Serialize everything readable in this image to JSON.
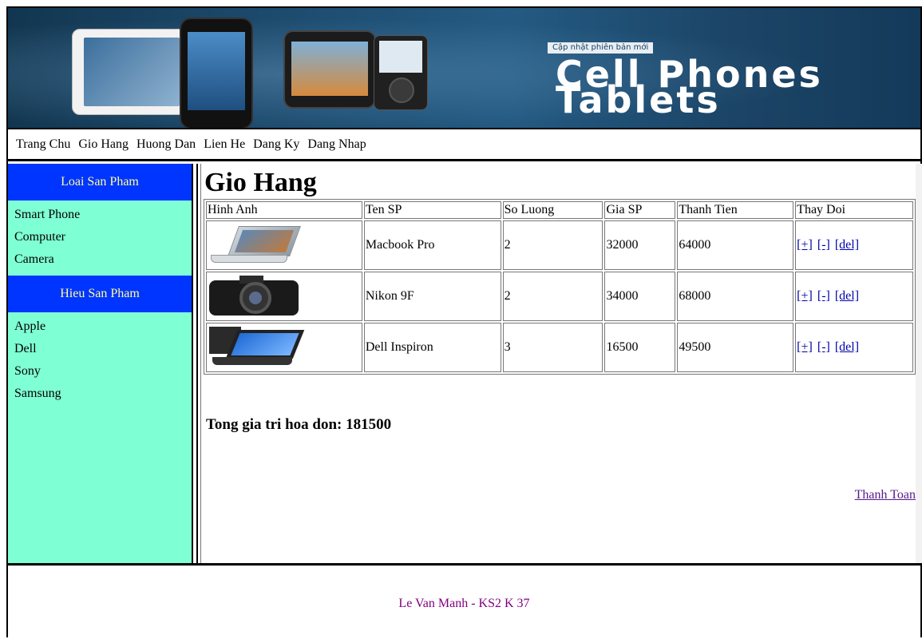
{
  "banner": {
    "tagline": "Cập nhật phiên bản mới",
    "title_line1": "Cell Phones",
    "title_line2": "Tablets"
  },
  "nav": {
    "items": [
      "Trang Chu",
      "Gio Hang",
      "Huong Dan",
      "Lien He",
      "Dang Ky",
      "Dang Nhap"
    ]
  },
  "sidebar": {
    "categories_title": "Loai San Pham",
    "categories": [
      "Smart Phone",
      "Computer",
      "Camera"
    ],
    "brands_title": "Hieu San Pham",
    "brands": [
      "Apple",
      "Dell",
      "Sony",
      "Samsung"
    ]
  },
  "cart": {
    "title": "Gio Hang",
    "headers": [
      "Hinh Anh",
      "Ten SP",
      "So Luong",
      "Gia SP",
      "Thanh Tien",
      "Thay Doi"
    ],
    "rows": [
      {
        "image": "macbook-image",
        "name": "Macbook Pro",
        "qty": "2",
        "price": "32000",
        "subtotal": "64000"
      },
      {
        "image": "camera-image",
        "name": "Nikon 9F",
        "qty": "2",
        "price": "34000",
        "subtotal": "68000"
      },
      {
        "image": "laptop-image",
        "name": "Dell Inspiron",
        "qty": "3",
        "price": "16500",
        "subtotal": "49500"
      }
    ],
    "actions": {
      "increase": "[+]",
      "decrease": "[-]",
      "delete": "[del]"
    },
    "total_text": "Tong gia tri hoa don: 181500",
    "checkout_label": "Thanh Toan"
  },
  "footer": {
    "text": "Le Van Manh - KS2 K 37"
  },
  "colors": {
    "sidebar_bg": "#7fffd4",
    "sidebar_header_bg": "#0035ff",
    "sidebar_header_text": "#ffff99",
    "banner_bg": "#1d4b6e",
    "footer_text": "#800080",
    "link": "#0000aa"
  }
}
